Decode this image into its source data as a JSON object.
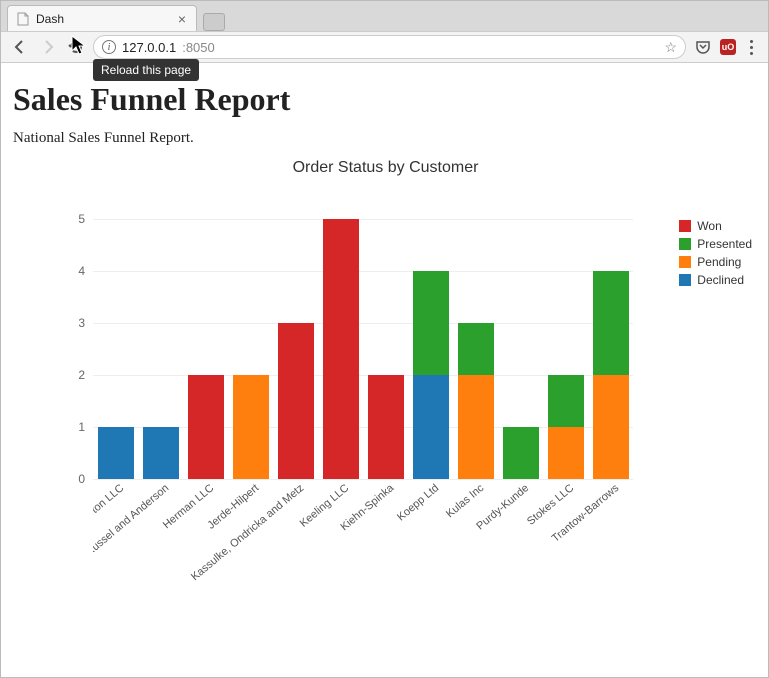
{
  "browser": {
    "tab_title": "Dash",
    "tooltip_reload": "Reload this page",
    "url_host": "127.0.0.1",
    "url_port": ":8050",
    "ext_badge": "uO"
  },
  "page": {
    "heading": "Sales Funnel Report",
    "subtext": "National Sales Funnel Report."
  },
  "legend": {
    "won": "Won",
    "presented": "Presented",
    "pending": "Pending",
    "declined": "Declined"
  },
  "chart_data": {
    "type": "bar",
    "title": "Order Status by Customer",
    "xlabel": "",
    "ylabel": "",
    "ylim": [
      0,
      5
    ],
    "yticks": [
      0,
      1,
      2,
      3,
      4,
      5
    ],
    "categories": [
      "Barton LLC",
      "Fritsch, Russel and Anderson",
      "Herman LLC",
      "Jerde-Hilpert",
      "Kassulke, Ondricka and Metz",
      "Keeling LLC",
      "Kiehn-Spinka",
      "Koepp Ltd",
      "Kulas Inc",
      "Purdy-Kunde",
      "Stokes LLC",
      "Trantow-Barrows"
    ],
    "series": [
      {
        "name": "Declined",
        "color": "#1f77b4",
        "values": [
          1,
          1,
          0,
          0,
          0,
          0,
          0,
          2,
          0,
          0,
          0,
          0
        ]
      },
      {
        "name": "Pending",
        "color": "#ff7f0e",
        "values": [
          0,
          0,
          0,
          2,
          0,
          0,
          0,
          0,
          2,
          0,
          1,
          2
        ]
      },
      {
        "name": "Presented",
        "color": "#2ca02c",
        "values": [
          0,
          0,
          0,
          0,
          0,
          0,
          0,
          2,
          1,
          1,
          1,
          2
        ]
      },
      {
        "name": "Won",
        "color": "#d62728",
        "values": [
          0,
          0,
          2,
          0,
          3,
          5,
          2,
          0,
          0,
          0,
          0,
          0
        ]
      }
    ],
    "legend_order": [
      "Won",
      "Presented",
      "Pending",
      "Declined"
    ]
  }
}
